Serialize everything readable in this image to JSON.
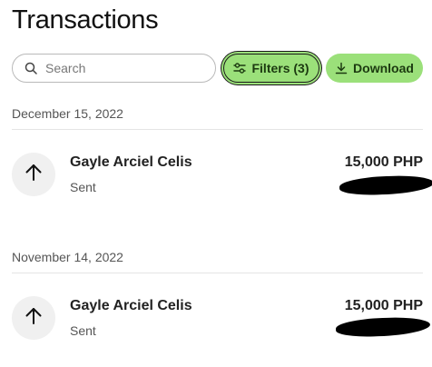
{
  "page": {
    "title": "Transactions"
  },
  "toolbar": {
    "search_placeholder": "Search",
    "search_value": "",
    "filters_label": "Filters (3)",
    "download_label": "Download"
  },
  "groups": [
    {
      "date": "December 15, 2022",
      "transactions": [
        {
          "name": "Gayle Arciel Celis",
          "status": "Sent",
          "amount": "15,000 PHP",
          "sub_amount": ""
        }
      ]
    },
    {
      "date": "November 14, 2022",
      "transactions": [
        {
          "name": "Gayle Arciel Celis",
          "status": "Sent",
          "amount": "15,000 PHP",
          "sub_amount": ""
        }
      ]
    }
  ],
  "colors": {
    "accent": "#9be07a",
    "accent_text": "#1c3a10",
    "icon_bg": "#f0f0f0"
  },
  "icons": {
    "search": "search-icon",
    "filters": "sliders-icon",
    "download": "download-icon",
    "transaction": "arrow-up-icon"
  }
}
